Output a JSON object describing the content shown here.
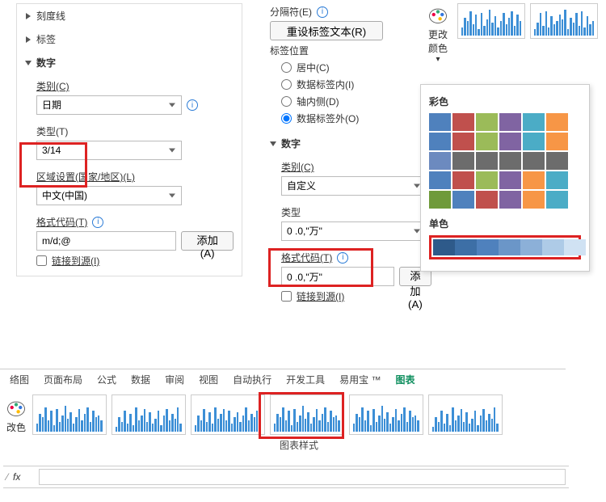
{
  "left": {
    "ticks": "刻度线",
    "labels": "标签",
    "number": "数字",
    "category_label": "类别(C)",
    "category_value": "日期",
    "type_label": "类型(T)",
    "type_value": "3/14",
    "region_label": "区域设置(国家/地区)(L)",
    "region_value": "中文(中国)",
    "format_label": "格式代码(T)",
    "format_value": "m/d;@",
    "add_btn": "添加(A)",
    "link_source": "链接到源(I)"
  },
  "right": {
    "separator": "分隔符(E)",
    "reset_btn": "重设标签文本(R)",
    "label_pos": "标签位置",
    "pos_center": "居中(C)",
    "pos_inside": "数据标签内(I)",
    "pos_axis": "轴内侧(D)",
    "pos_outside": "数据标签外(O)",
    "number": "数字",
    "category_label": "类别(C)",
    "category_value": "自定义",
    "type_label": "类型",
    "type_value": "0 .0,\"万\"",
    "format_label": "格式代码(T)",
    "format_value": "0 .0,\"万\"",
    "add_btn": "添加(A)",
    "link_source": "链接到源(I)"
  },
  "color_tool": {
    "label": "更改\n颜色"
  },
  "palette": {
    "colorful_heading": "彩色",
    "mono_heading": "单色",
    "rows": [
      [
        "#4f81bd",
        "#c0504d",
        "#9bbb59",
        "#8064a2",
        "#4bacc6",
        "#f79646"
      ],
      [
        "#4f81bd",
        "#c0504d",
        "#9bbb59",
        "#8064a2",
        "#4bacc6",
        "#f79646"
      ],
      [
        "#6c8abf",
        "#6c6c6c",
        "#6c6c6c",
        "#6c6c6c",
        "#6c6c6c",
        "#6c6c6c"
      ],
      [
        "#4f81bd",
        "#c0504d",
        "#9bbb59",
        "#8064a2",
        "#f79646",
        "#4bacc6"
      ],
      [
        "#6f9a3a",
        "#4f81bd",
        "#c0504d",
        "#8064a2",
        "#f79646",
        "#4bacc6"
      ]
    ],
    "mono": [
      "#2e5a8a",
      "#3d6fa6",
      "#4f81bd",
      "#6b96c8",
      "#8cb0d8",
      "#aecbe7",
      "#d0e2f3"
    ]
  },
  "ribbon": {
    "items": [
      "络图",
      "页面布局",
      "公式",
      "数据",
      "审阅",
      "视图",
      "自动执行",
      "开发工具",
      "易用宝 ™",
      "图表"
    ]
  },
  "chart_styles_caption": "图表样式",
  "left_color_btn": "改色",
  "formula": {
    "fx": "fx"
  },
  "mini_bars_top_a": [
    10,
    22,
    18,
    30,
    14,
    26,
    8,
    28,
    12,
    20,
    32,
    16,
    24,
    10,
    18,
    28,
    14,
    22,
    30,
    12,
    26,
    18
  ],
  "mini_bars_top_b": [
    8,
    16,
    28,
    12,
    30,
    10,
    24,
    14,
    18,
    26,
    20,
    32,
    8,
    22,
    16,
    28,
    12,
    30,
    10,
    24,
    14,
    18
  ],
  "chart_row_bars": [
    [
      10,
      22,
      18,
      30,
      14,
      26,
      8,
      28,
      12,
      20,
      32,
      16,
      24,
      10,
      18,
      28,
      14,
      22,
      30,
      12,
      26,
      18,
      20,
      14
    ],
    [
      6,
      18,
      12,
      26,
      10,
      22,
      8,
      30,
      14,
      20,
      28,
      12,
      24,
      10,
      16,
      26,
      8,
      20,
      28,
      14,
      22,
      16,
      30,
      10
    ],
    [
      8,
      20,
      14,
      28,
      12,
      24,
      10,
      30,
      16,
      22,
      28,
      14,
      26,
      10,
      18,
      24,
      12,
      20,
      30,
      14,
      22,
      18,
      26,
      10
    ],
    [
      10,
      22,
      18,
      30,
      14,
      26,
      8,
      28,
      12,
      20,
      32,
      16,
      24,
      10,
      18,
      28,
      14,
      22,
      30,
      12,
      26,
      18,
      20,
      14
    ],
    [
      10,
      22,
      18,
      30,
      14,
      26,
      8,
      28,
      12,
      20,
      32,
      16,
      24,
      10,
      18,
      28,
      14,
      22,
      30,
      12,
      26,
      18,
      20,
      14
    ],
    [
      6,
      18,
      12,
      26,
      10,
      22,
      8,
      30,
      14,
      20,
      28,
      12,
      24,
      10,
      16,
      26,
      8,
      20,
      28,
      14,
      22,
      16,
      30,
      10
    ]
  ]
}
